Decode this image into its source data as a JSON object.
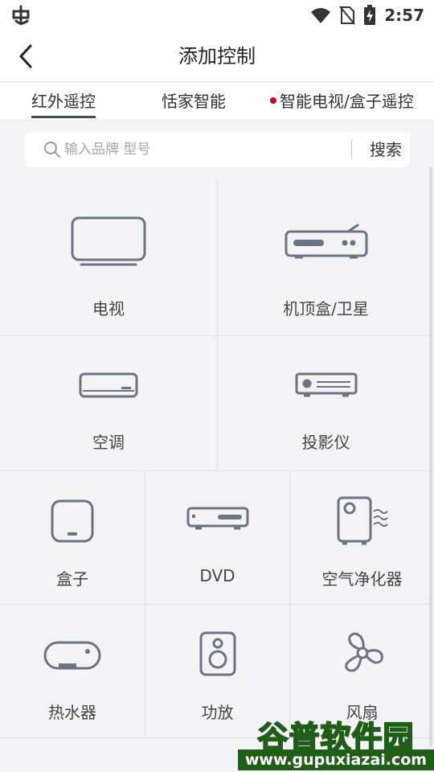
{
  "status_bar": {
    "time": "2:57"
  },
  "header": {
    "title": "添加控制"
  },
  "tabs": [
    {
      "label": "红外遥控"
    },
    {
      "label": "恬家智能"
    },
    {
      "label": "智能电视/盒子遥控"
    }
  ],
  "search": {
    "placeholder": "输入品牌 型号",
    "value": "",
    "button_label": "搜索"
  },
  "devices": [
    {
      "label": "电视",
      "icon": "tv-icon"
    },
    {
      "label": "机顶盒/卫星",
      "icon": "set-top-box-icon"
    },
    {
      "label": "空调",
      "icon": "air-conditioner-icon"
    },
    {
      "label": "投影仪",
      "icon": "projector-icon"
    },
    {
      "label": "盒子",
      "icon": "box-icon"
    },
    {
      "label": "DVD",
      "icon": "dvd-icon"
    },
    {
      "label": "空气净化器",
      "icon": "air-purifier-icon"
    },
    {
      "label": "热水器",
      "icon": "water-heater-icon"
    },
    {
      "label": "功放",
      "icon": "amplifier-icon"
    },
    {
      "label": "风扇",
      "icon": "fan-icon"
    }
  ],
  "watermark": {
    "title": "谷普软件园",
    "url": "www.gupuxiazai.com"
  },
  "colors": {
    "icon_stroke": "#6b7386",
    "tab_indicator": "#3d4a63",
    "tab_dot": "#d0021b",
    "watermark_green": "#3aa32b"
  }
}
